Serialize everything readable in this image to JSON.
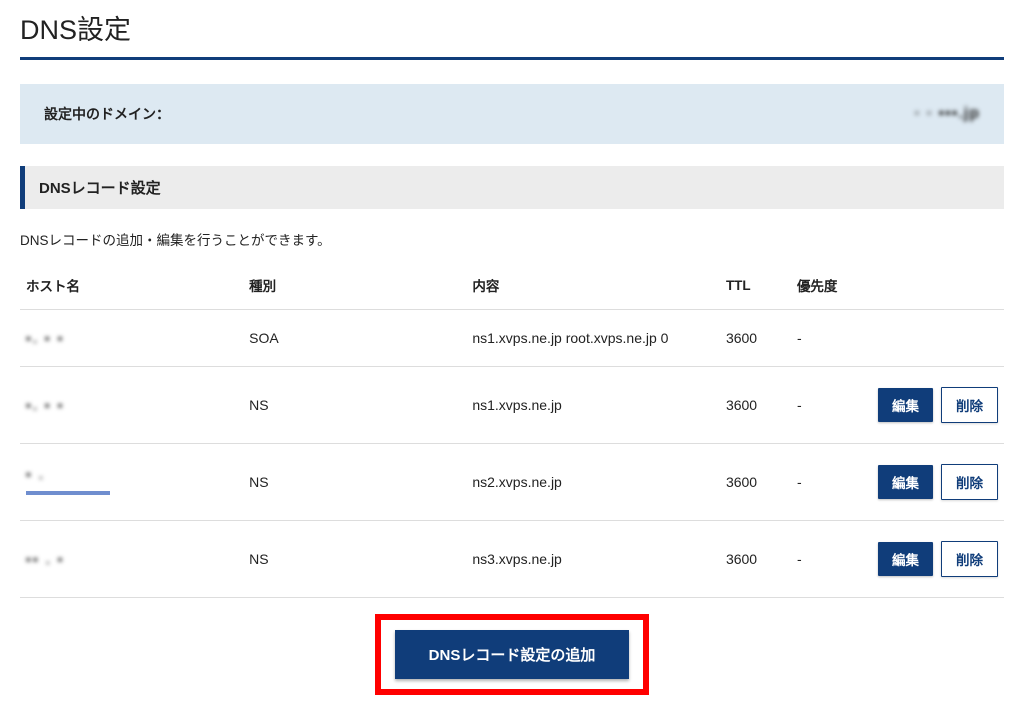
{
  "page": {
    "title": "DNS設定"
  },
  "domain_bar": {
    "label": "設定中のドメイン：",
    "value": "◦ ◦ ▪▪▪.jp"
  },
  "section": {
    "title": "DNSレコード設定",
    "description": "DNSレコードの追加・編集を行うことができます。"
  },
  "table": {
    "headers": {
      "host": "ホスト名",
      "type": "種別",
      "content": "内容",
      "ttl": "TTL",
      "priority": "優先度"
    },
    "rows": [
      {
        "host": "▪. ▪ ▪",
        "type": "SOA",
        "content": "ns1.xvps.ne.jp root.xvps.ne.jp 0",
        "ttl": "3600",
        "priority": "-",
        "editable": false
      },
      {
        "host": "▪. ▪ ▪",
        "type": "NS",
        "content": "ns1.xvps.ne.jp",
        "ttl": "3600",
        "priority": "-",
        "editable": true,
        "accent": false
      },
      {
        "host": "▪ .",
        "type": "NS",
        "content": "ns2.xvps.ne.jp",
        "ttl": "3600",
        "priority": "-",
        "editable": true,
        "accent": true
      },
      {
        "host": "▪▪ . ▪",
        "type": "NS",
        "content": "ns3.xvps.ne.jp",
        "ttl": "3600",
        "priority": "-",
        "editable": true,
        "accent": false
      }
    ]
  },
  "buttons": {
    "edit": "編集",
    "delete": "削除",
    "add": "DNSレコード設定の追加"
  }
}
